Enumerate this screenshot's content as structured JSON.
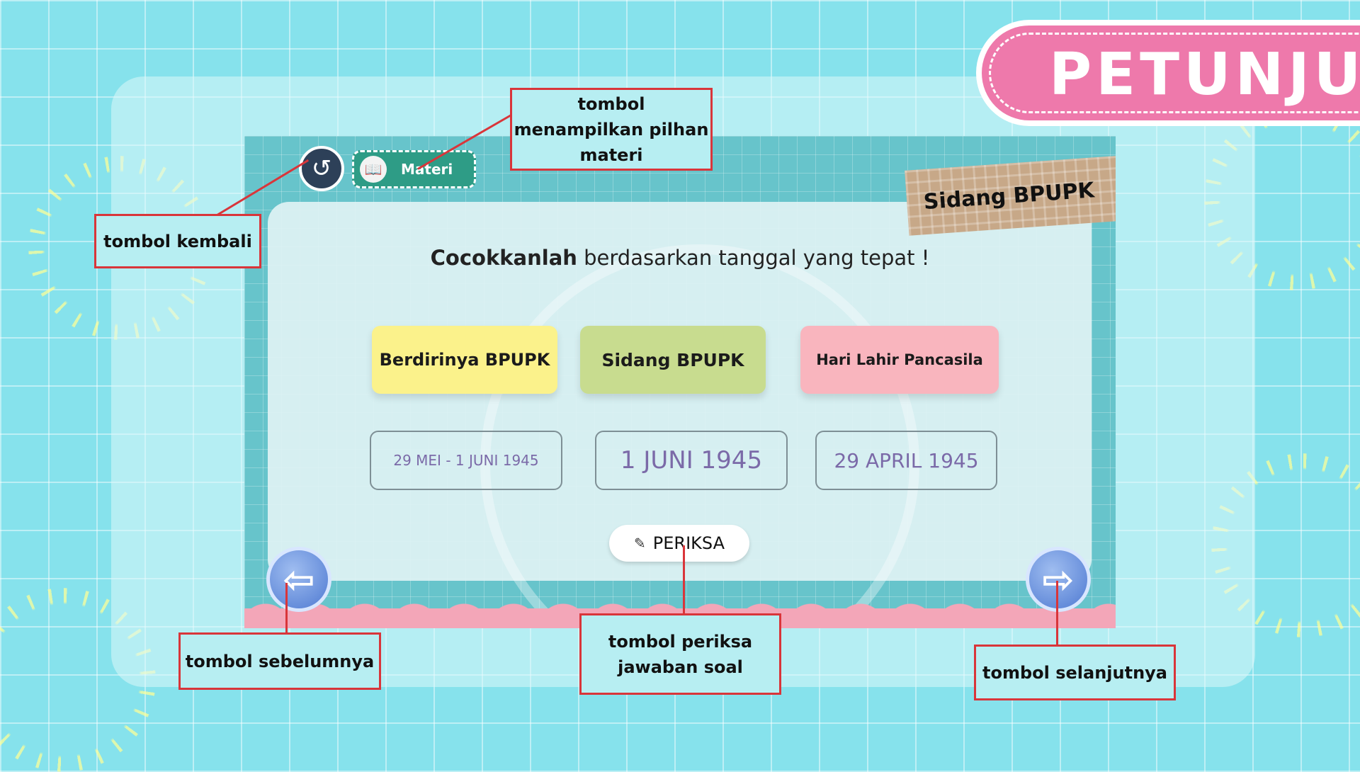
{
  "header": {
    "title": "PETUNJUK"
  },
  "game": {
    "back_icon": "↺",
    "materi_label": "Materi",
    "materi_icon": "book-icon",
    "topic": "Sidang BPUPK",
    "instruction_bold": "Cocokkanlah",
    "instruction_rest": " berdasarkan tanggal yang tepat !",
    "cards": [
      "Berdirinya BPUPK",
      "Sidang BPUPK",
      "Hari Lahir Pancasila"
    ],
    "slots": [
      "29 MEI - 1 JUNI 1945",
      "1 JUNI 1945",
      "29 APRIL 1945"
    ],
    "check_label": "PERIKSA",
    "prev_icon": "⇦",
    "next_icon": "⇨"
  },
  "callouts": {
    "materi": "tombol menampilkan pilhan materi",
    "kembali": "tombol kembali",
    "sebelumnya": "tombol sebelumnya",
    "periksa": "tombol periksa jawaban soal",
    "selanjutnya": "tombol selanjutnya"
  },
  "colors": {
    "background": "#86e2ec",
    "banner": "#ee79ab",
    "callout_border": "#d9353a",
    "card_yellow": "#fbf28b",
    "card_green": "#c8dc8f",
    "card_pink": "#f9b5be"
  }
}
